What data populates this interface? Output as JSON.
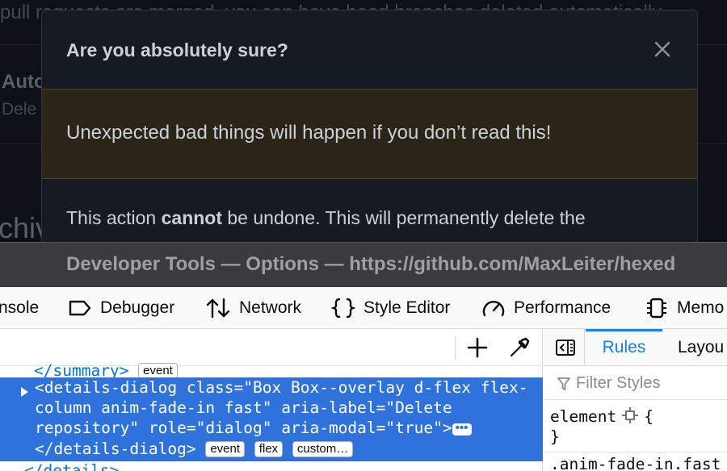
{
  "page": {
    "background_text": "pull requests are merged, you can have head branches deleted automatically",
    "section_title_fragment": "Auto",
    "section_desc_fragment": "Dele",
    "heading_fragment": "chiv"
  },
  "dialog": {
    "title": "Are you absolutely sure?",
    "close_icon": "close-icon",
    "warning": "Unexpected bad things will happen if you don’t read this!",
    "body_prefix": "This action ",
    "body_bold": "cannot",
    "body_suffix": " be undone. This will permanently delete the"
  },
  "devtools": {
    "title": "Developer Tools — Options — https://github.com/MaxLeiter/hexed",
    "tabs": [
      {
        "label": "nsole",
        "icon": "console-icon"
      },
      {
        "label": "Debugger",
        "icon": "debugger-icon"
      },
      {
        "label": "Network",
        "icon": "network-icon"
      },
      {
        "label": "Style Editor",
        "icon": "style-editor-icon"
      },
      {
        "label": "Performance",
        "icon": "performance-icon"
      },
      {
        "label": "Memo",
        "icon": "memory-icon"
      }
    ],
    "markup": {
      "summary_tag": "</summary>",
      "summary_badge": "event",
      "selected_lines": [
        "<details-dialog class=\"Box Box--overlay d-flex flex-",
        "column anim-fade-in fast\" aria-label=\"Delete",
        "repository\" role=\"dialog\" aria-modal=\"true\">",
        "</details-dialog>"
      ],
      "badges": [
        "event",
        "flex",
        "custom…"
      ],
      "closing_tag": "</details>"
    },
    "sidebar": {
      "rules_tab": "Rules",
      "layout_tab": "Layou",
      "filter_placeholder": "Filter Styles",
      "element_selector": "element",
      "element_open": "{",
      "element_close": "}",
      "next_rule": ".anim-fade-in.fast"
    }
  }
}
